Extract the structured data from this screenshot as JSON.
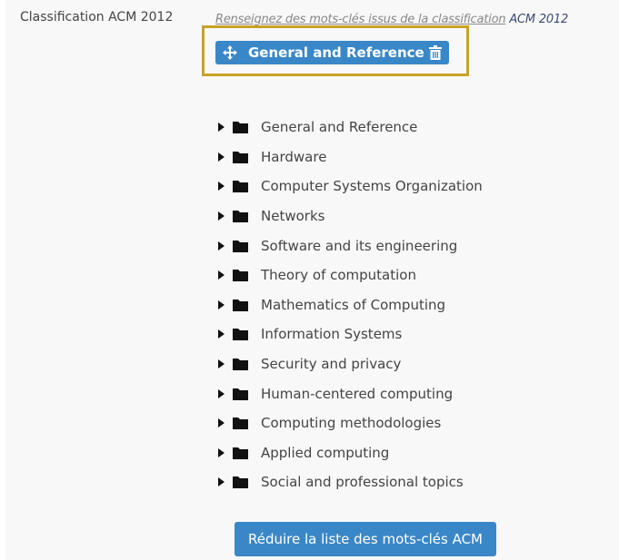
{
  "field": {
    "label": "Classification ACM 2012",
    "help_prefix": "Renseignez des mots-clés issus de la classification",
    "help_link": "ACM 2012"
  },
  "selected_keywords": [
    {
      "label": "General and Reference",
      "move_icon": "move-icon",
      "delete_icon": "trash-icon"
    }
  ],
  "tree": {
    "items": [
      {
        "label": "General and Reference"
      },
      {
        "label": "Hardware"
      },
      {
        "label": "Computer Systems Organization"
      },
      {
        "label": "Networks"
      },
      {
        "label": "Software and its engineering"
      },
      {
        "label": "Theory of computation"
      },
      {
        "label": "Mathematics of Computing"
      },
      {
        "label": "Information Systems"
      },
      {
        "label": "Security and privacy"
      },
      {
        "label": "Human-centered computing"
      },
      {
        "label": "Computing methodologies"
      },
      {
        "label": "Applied computing"
      },
      {
        "label": "Social and professional topics"
      }
    ]
  },
  "reduce_button": {
    "label": "Réduire la liste des mots-clés ACM"
  },
  "colors": {
    "accent": "#3a87c8",
    "highlight": "#c9a227",
    "text": "#444444"
  }
}
